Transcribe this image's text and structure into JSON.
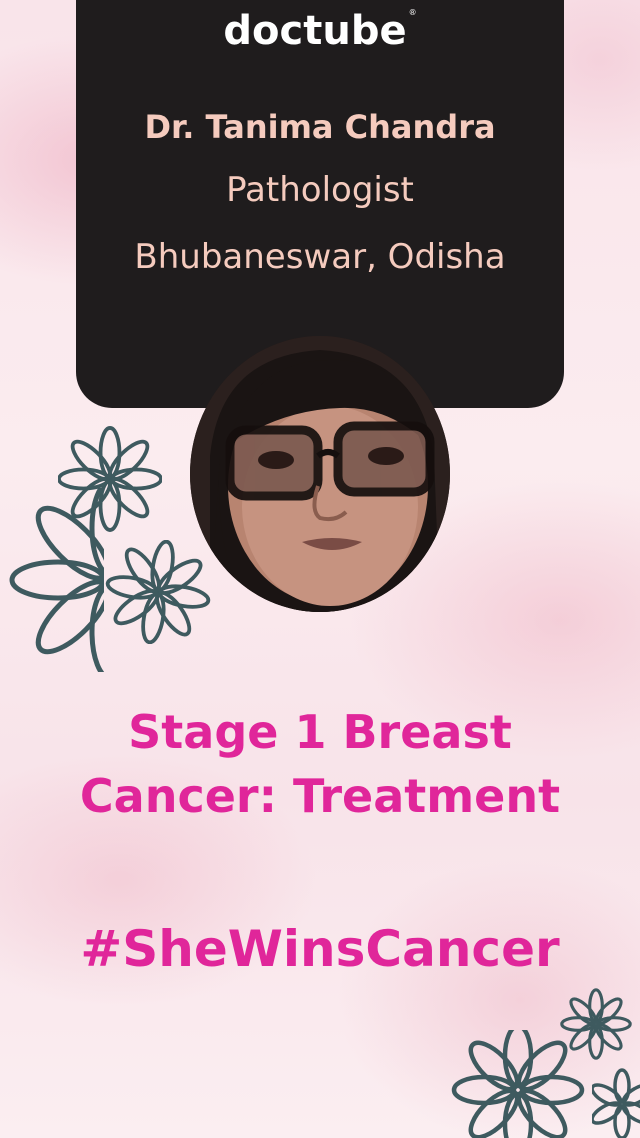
{
  "brand": {
    "logo_text": "doctube",
    "trademark": "®"
  },
  "doctor": {
    "name": "Dr. Tanima Chandra",
    "specialty": "Pathologist",
    "location": "Bhubaneswar, Odisha"
  },
  "headline": {
    "line1": "Stage 1 Breast",
    "line2": "Cancer: Treatment"
  },
  "hashtag": "#SheWinsCancer",
  "colors": {
    "background": "#f9e4ea",
    "card": "#1f1c1d",
    "card_text": "#f5cbbe",
    "headline": "#e0269a",
    "flower_stroke": "#3e5a5f"
  },
  "icons": [
    "flower-icon"
  ]
}
